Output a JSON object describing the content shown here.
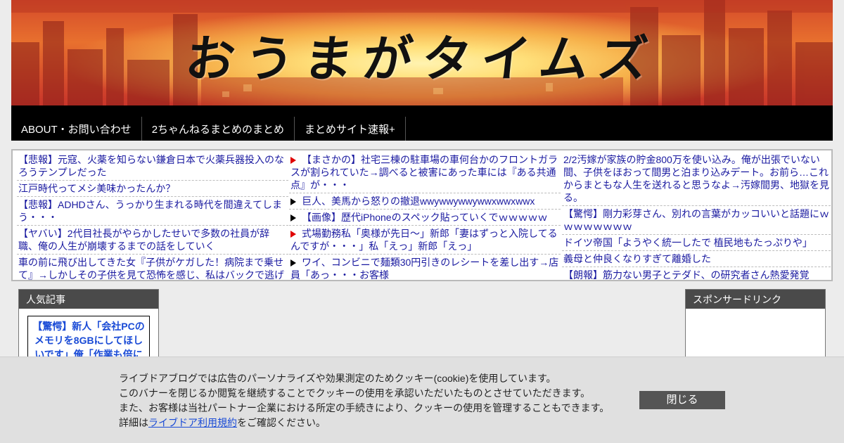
{
  "site": {
    "title": "おうまがタイムズ"
  },
  "nav": {
    "items": [
      {
        "label": "ABOUT・お問い合わせ"
      },
      {
        "label": "2ちゃんねるまとめのまとめ"
      },
      {
        "label": "まとめサイト速報+"
      }
    ]
  },
  "links": {
    "col1": [
      {
        "text": "【悲報】元寇、火薬を知らない鎌倉日本で火薬兵器投入のなろうテンプレだった"
      },
      {
        "text": "江戸時代ってメシ美味かったんか？"
      },
      {
        "text": "【悲報】ADHDさん、うっかり生まれる時代を間違えてしまう・・・"
      },
      {
        "text": "【ヤバい】2代目社長がやらかしたせいで多数の社員が辞職、俺の人生が崩壊するまでの話をしていく"
      },
      {
        "text": "車の前に飛び出してきた女『子供がケガした！病院まで乗せて』→しかしその子供を見て恐怖を感じ、私はバックで逃げた"
      }
    ],
    "col2": [
      {
        "text": "【まさかの】社宅三棟の駐車場の車何台かのフロントガラスが割られていた→調べると被害にあった車には『ある共通点』が・・・",
        "marker": "red"
      },
      {
        "text": "巨人、美馬から怒りの撤退wwywwywwywwxwwxwwx",
        "marker": "black"
      },
      {
        "text": "【画像】歴代iPhoneのスペック貼っていくでｗｗｗｗｗ",
        "marker": "black"
      },
      {
        "text": "式場勤務私「奥様が先日〜」新郎「妻はずっと入院してるんですが・・・」私「えっ」新郎「えっ」",
        "marker": "red"
      },
      {
        "text": "ワイ、コンビニで麺類30円引きのレシートを差し出す→店員「あっ・・・お客様",
        "marker": "black"
      }
    ],
    "col3": [
      {
        "text": "2/2汚嫁が家族の貯金800万を使い込み。俺が出張でいない間、子供をほおって間男と泊まり込みデート。お前ら…これからまともな人生を送れると思うなよ→汚嫁間男、地獄を見る。"
      },
      {
        "text": "【驚愕】剛力彩芽さん、別れの言葉がカッコいいと話題にｗｗｗｗｗｗｗｗ"
      },
      {
        "text": "ドイツ帝国「ようやく統一したで 植民地もたっぷりや」"
      },
      {
        "text": "義母と仲良くなりすぎて離婚した"
      },
      {
        "text": "【朗報】筋力ない男子とテダド、の研究者さん熱愛発覚"
      }
    ]
  },
  "sidebar_left": {
    "header": "人気記事",
    "card_text": "【驚愕】新人「会社PCのメモリを8GBにしてほしいです」俺「作業も倍に"
  },
  "sidebar_right": {
    "header": "スポンサードリンク"
  },
  "cookie": {
    "line1": "ライブドアブログでは広告のパーソナライズや効果測定のためクッキー(cookie)を使用しています。",
    "line2": "このバナーを閉じるか閲覧を継続することでクッキーの使用を承認いただいたものとさせていただきます。",
    "line3": "また、お客様は当社パートナー企業における所定の手続きにより、クッキーの使用を管理することもできます。",
    "line4_prefix": "詳細は",
    "line4_link": "ライブドア利用規約",
    "line4_suffix": "をご確認ください。",
    "close_label": "閉じる"
  }
}
